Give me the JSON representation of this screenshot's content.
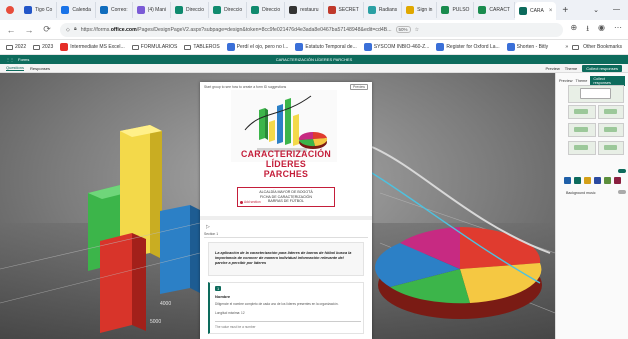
{
  "browser": {
    "tabs": [
      {
        "label": "Tigo Co",
        "color": "#2356c8"
      },
      {
        "label": "Calenda",
        "color": "#1a73e8"
      },
      {
        "label": "Correo:",
        "color": "#0f6cbd"
      },
      {
        "label": "(4) Mani",
        "color": "#7b5bd6"
      },
      {
        "label": "Direccio",
        "color": "#0f8a6e"
      },
      {
        "label": "Direccio",
        "color": "#0f8a6e"
      },
      {
        "label": "Direccio",
        "color": "#0f8a6e"
      },
      {
        "label": "restauru",
        "color": "#333333"
      },
      {
        "label": "SECRET",
        "color": "#c0392b"
      },
      {
        "label": "Radians",
        "color": "#2aa0a4"
      },
      {
        "label": "Sign in",
        "color": "#e0a800"
      },
      {
        "label": "PULSO",
        "color": "#1a8c4e"
      },
      {
        "label": "CARACT",
        "color": "#1a8c4e"
      },
      {
        "label": "CARA",
        "color": "#0d6b5c",
        "active": true
      }
    ],
    "url_prefix": "https://forms.",
    "url_domain": "office.com",
    "url_rest": "/Pages/DesignPageV2.aspx?subpage=design&token=8cc9fe021476d4e3ada8e0467ba57148948&edit=cd4B...",
    "zoom": "50%",
    "bookmarks": [
      {
        "label": "2022",
        "type": "folder"
      },
      {
        "label": "2023",
        "type": "folder"
      },
      {
        "label": "Intermediate MS Excel...",
        "type": "video"
      },
      {
        "label": "FORMULARIOS",
        "type": "folder"
      },
      {
        "label": "TABLEROS",
        "type": "folder"
      },
      {
        "label": "Perdí el ojo, pero no l...",
        "type": "link"
      },
      {
        "label": "Estatuto Temporal de...",
        "type": "link"
      },
      {
        "label": "SYSCOM INBIO-460-Z...",
        "type": "link"
      },
      {
        "label": "Register for Oxford La...",
        "type": "link"
      },
      {
        "label": "Shorten - Bitly",
        "type": "link"
      }
    ],
    "other_bookmarks": "Other Bookmarks"
  },
  "app": {
    "home": "Forms",
    "doc_title": "CARACTERIZACIÓN LÍDERES PARCHES",
    "questions_tab": "Questions",
    "responses_tab": "Responses",
    "preview_label": "Preview",
    "theme_label": "Theme",
    "collect_label": "Collect responses"
  },
  "panel": {
    "swatch_colors": [
      "#1f5fa8",
      "#0d6b5c",
      "#d4a017",
      "#2b4aa0",
      "#5c8f3c",
      "#8a1f3f"
    ],
    "background_label": "Background music"
  },
  "form": {
    "top_left": "Start group to see how to create a form ID suggestions",
    "preview_btn": "Preview",
    "title_lines": [
      "CARACTERIZACIÓN",
      "LÍDERES",
      "PARCHES"
    ],
    "subtitle_lines": [
      "ALCALDÍA MAYOR DE BOGOTÁ",
      "FICHA DE CARACTERIZACIÓN",
      "BARRAS DE FÚTBOL"
    ],
    "red_link": "Add section",
    "section_label": "Section 1",
    "description": "La aplicación de la caracterización para líderes de barras de fútbol busca la importancia de conocer de manera individual información relevante del parche a percibir por líderes",
    "question": {
      "number": "1",
      "title": "Nombre",
      "line1": "Diligencie el nombre completo de cada uno de los líderes presentes en la organización.",
      "line2": "Longitud máxima: 12",
      "answer_hint": "The value must be a number"
    }
  }
}
